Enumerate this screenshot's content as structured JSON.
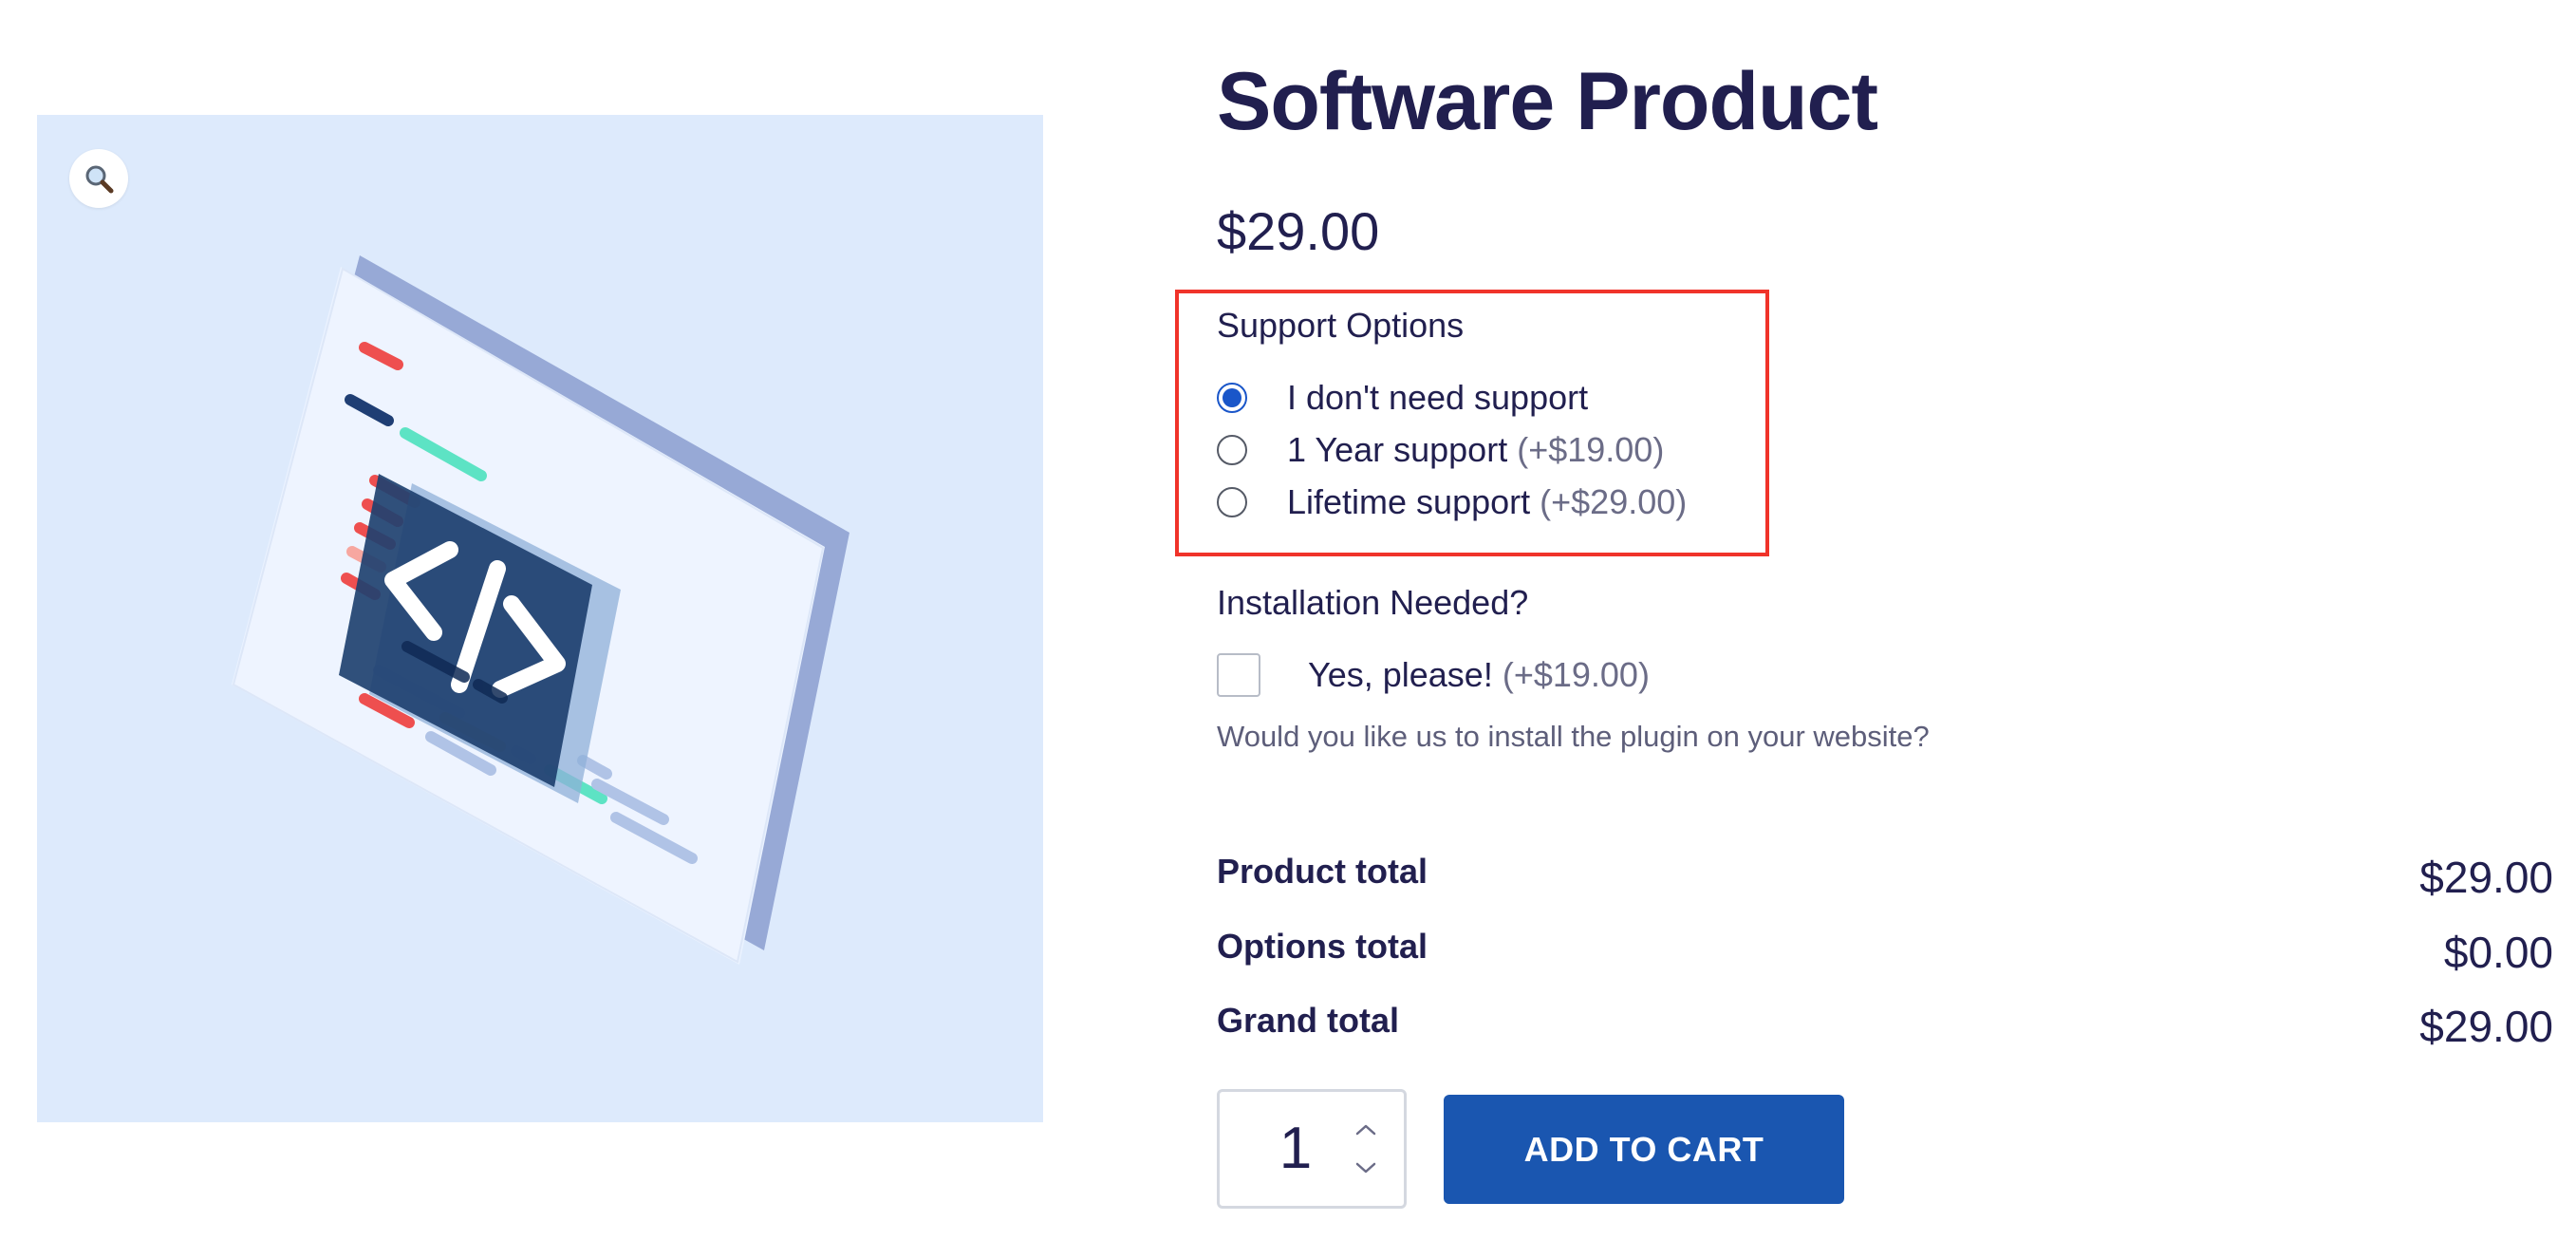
{
  "product": {
    "title": "Software Product",
    "price": "$29.00"
  },
  "image": {
    "background_color": "#ddeafc",
    "icon": "code-brackets-icon",
    "zoom_icon": "magnifier-icon"
  },
  "support_options": {
    "label": "Support Options",
    "options": [
      {
        "label": "I don't need support",
        "price": "",
        "selected": true
      },
      {
        "label": "1 Year support",
        "price": "(+$19.00)",
        "selected": false
      },
      {
        "label": "Lifetime support",
        "price": "(+$29.00)",
        "selected": false
      }
    ]
  },
  "installation": {
    "label": "Installation Needed?",
    "checkbox_label": "Yes, please!",
    "checkbox_price": "(+$19.00)",
    "checked": false,
    "description": "Would you like us to install the plugin on your website?"
  },
  "totals": {
    "product_total_label": "Product total",
    "product_total_value": "$29.00",
    "options_total_label": "Options total",
    "options_total_value": "$0.00",
    "grand_total_label": "Grand total",
    "grand_total_value": "$29.00"
  },
  "cart": {
    "quantity": "1",
    "add_to_cart_label": "ADD TO CART"
  },
  "colors": {
    "text": "#211f4f",
    "accent": "#1a56b0",
    "highlight_border": "#f0332a"
  }
}
